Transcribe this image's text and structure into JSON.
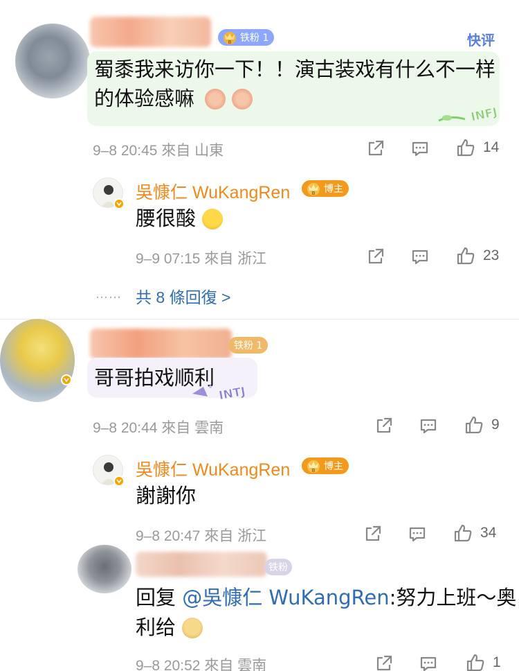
{
  "comments": [
    {
      "badge": "铁粉 1",
      "quick_label": "快评",
      "text_line1": "蜀黍我来访你一下！！演古装戏有什么不一样",
      "text_line2": "的体验感嘛",
      "sticker": "INFJ",
      "meta": "9–8 20:45  來自 山東",
      "likes": "14",
      "reply": {
        "author": "吳慷仁 WuKangRen",
        "badge": "博主",
        "text": "腰很酸",
        "meta": "9–9 07:15  來自 浙江",
        "likes": "23"
      },
      "more_dots": "……",
      "more_replies": "共 8 條回復 >"
    },
    {
      "badge": "铁粉 1",
      "text": "哥哥拍戏顺利",
      "sticker": "INTJ",
      "meta": "9–8 20:44  來自 雲南",
      "likes": "9",
      "reply": {
        "author": "吳慷仁 WuKangRen",
        "badge": "博主",
        "text": "謝謝你",
        "meta": "9–8 20:47  來自 浙江",
        "likes": "34"
      },
      "reply2": {
        "badge": "铁粉",
        "prefix": "回复 ",
        "mention": "@吳慷仁 WuKangRen",
        "text_line1": ":努力上班～奥",
        "text_line2": "利给",
        "meta": "9–8 20:52  來自 雲南",
        "likes": "1"
      }
    }
  ],
  "colors": {
    "accent": "#f08a1a",
    "link": "#2f6db5",
    "bubble": "#ecf8ea",
    "meta": "#9a9a9a"
  },
  "icons": [
    "share-icon",
    "comment-icon",
    "like-icon",
    "vip-badge-icon",
    "emoji-icon"
  ]
}
